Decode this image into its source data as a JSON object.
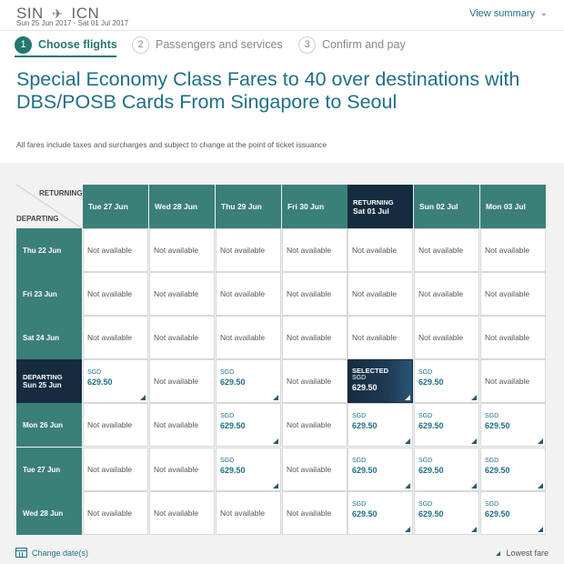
{
  "header": {
    "origin": "SIN",
    "destination": "ICN",
    "plane_icon": "plane-icon",
    "dates": "Sun 25 Jun 2017 - Sat 01 Jul 2017",
    "view_summary": "View summary"
  },
  "steps": [
    {
      "num": "1",
      "label": "Choose flights"
    },
    {
      "num": "2",
      "label": "Passengers and services"
    },
    {
      "num": "3",
      "label": "Confirm and pay"
    }
  ],
  "title": "Special Economy Class Fares to 40 over destinations with DBS/POSB Cards From Singapore to Seoul",
  "subtitle": "All fares include taxes and surcharges and subject to change at the point of ticket issuance",
  "grid": {
    "returning_label": "RETURNING",
    "departing_label": "DEPARTING",
    "currency": "SGD",
    "not_available": "Not available",
    "selected_label": "SELECTED",
    "columns": [
      {
        "label": "Tue 27 Jun",
        "prefix": ""
      },
      {
        "label": "Wed 28 Jun",
        "prefix": ""
      },
      {
        "label": "Thu 29 Jun",
        "prefix": ""
      },
      {
        "label": "Fri 30 Jun",
        "prefix": ""
      },
      {
        "label": "Sat 01 Jul",
        "prefix": "RETURNING",
        "selected": true
      },
      {
        "label": "Sun 02 Jul",
        "prefix": ""
      },
      {
        "label": "Mon 03 Jul",
        "prefix": ""
      }
    ],
    "rows": [
      {
        "label": "Thu 22 Jun",
        "prefix": "",
        "cells": [
          null,
          null,
          null,
          null,
          null,
          null,
          null
        ]
      },
      {
        "label": "Fri 23 Jun",
        "prefix": "",
        "cells": [
          null,
          null,
          null,
          null,
          null,
          null,
          null
        ]
      },
      {
        "label": "Sat 24 Jun",
        "prefix": "",
        "cells": [
          null,
          null,
          null,
          null,
          null,
          null,
          null
        ]
      },
      {
        "label": "Sun 25 Jun",
        "prefix": "DEPARTING",
        "selected": true,
        "cells": [
          "629.50",
          null,
          "629.50",
          null,
          "629.50",
          "629.50",
          null
        ]
      },
      {
        "label": "Mon 26 Jun",
        "prefix": "",
        "cells": [
          null,
          null,
          "629.50",
          null,
          "629.50",
          "629.50",
          "629.50"
        ]
      },
      {
        "label": "Tue 27 Jun",
        "prefix": "",
        "cells": [
          null,
          null,
          "629.50",
          null,
          "629.50",
          "629.50",
          "629.50"
        ]
      },
      {
        "label": "Wed 28 Jun",
        "prefix": "",
        "cells": [
          null,
          null,
          null,
          null,
          "629.50",
          "629.50",
          "629.50"
        ]
      }
    ]
  },
  "footer": {
    "change_dates": "Change date(s)",
    "calendar_icon": "calendar-icon",
    "lowest_fare": "Lowest fare"
  },
  "colors": {
    "header_teal": "#3b7f79",
    "selected_navy": "#152c40",
    "link_blue": "#1f6f85"
  }
}
